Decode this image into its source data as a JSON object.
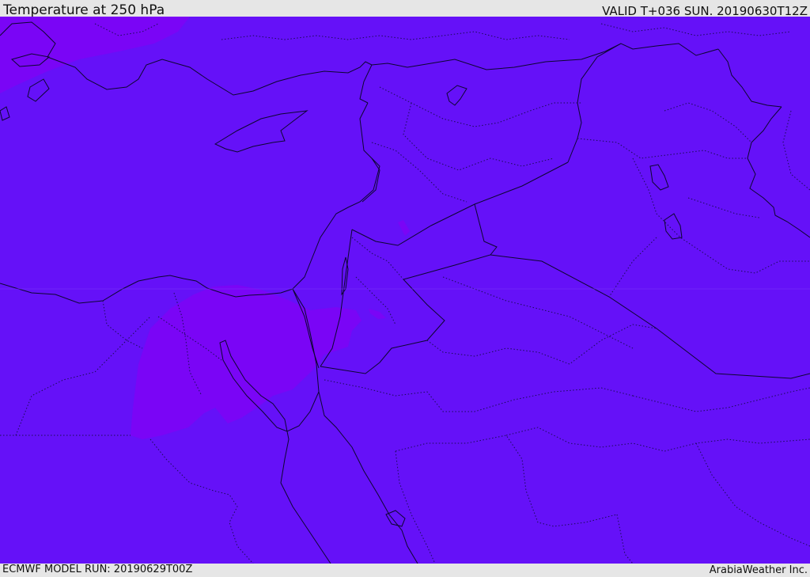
{
  "header": {
    "title": "Temperature at 250 hPa",
    "valid": "VALID T+036 SUN. 20190630T12Z"
  },
  "footer": {
    "model_run": "ECMWF MODEL RUN: 20190629T00Z",
    "credit": "ArabiaWeather Inc."
  },
  "map": {
    "base_color": "#6511f8",
    "warm_color": "#7a05f6",
    "line_color": "#0d0630"
  }
}
